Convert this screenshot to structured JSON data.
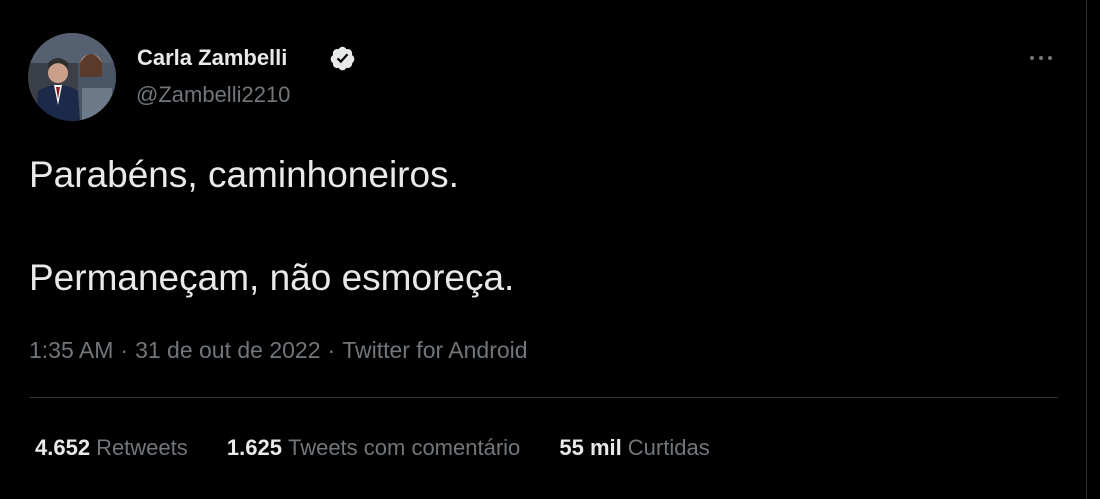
{
  "tweet": {
    "author": {
      "display_name": "Carla Zambelli",
      "handle": "@Zambelli2210",
      "verified": true
    },
    "text_lines": [
      "Parabéns, caminhoneiros.",
      "Permaneçam, não esmoreça."
    ],
    "meta": {
      "time": "1:35 AM",
      "date": "31 de out de 2022",
      "source": "Twitter for Android",
      "separator": "·"
    },
    "stats": {
      "retweets": {
        "count": "4.652",
        "label": "Retweets"
      },
      "quotes": {
        "count": "1.625",
        "label": "Tweets com comentário"
      },
      "likes": {
        "count": "55 mil",
        "label": "Curtidas"
      }
    }
  },
  "icons": {
    "verified": "verified-badge-icon",
    "more": "more-options-icon"
  },
  "colors": {
    "background": "#000000",
    "primary_text": "#e7e9ea",
    "secondary_text": "#71767b",
    "divider": "#2f3336"
  }
}
